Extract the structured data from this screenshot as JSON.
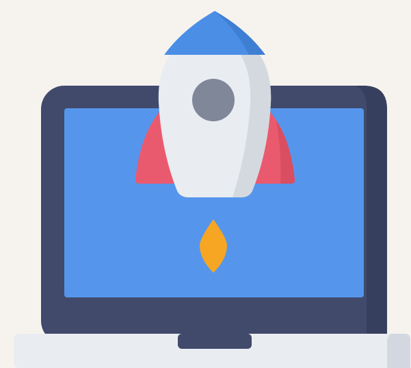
{
  "illustration": {
    "subject": "laptop-rocket-launch-icon",
    "colors": {
      "background": "#f6f3ef",
      "laptop_frame": "#414a6b",
      "laptop_frame_shadow": "#373f5e",
      "screen": "#5596ec",
      "laptop_base": "#e9ecf1",
      "laptop_base_shadow": "#d3d8e0",
      "rocket_body": "#e9ecf1",
      "rocket_body_shadow": "#d4d9e0",
      "rocket_nose": "#4b8ee6",
      "rocket_nose_shadow": "#3f7fd3",
      "rocket_fins": "#ea5a6f",
      "rocket_fins_shadow": "#d94e61",
      "rocket_window": "#7f8798",
      "rocket_flame": "#f6a623"
    }
  }
}
